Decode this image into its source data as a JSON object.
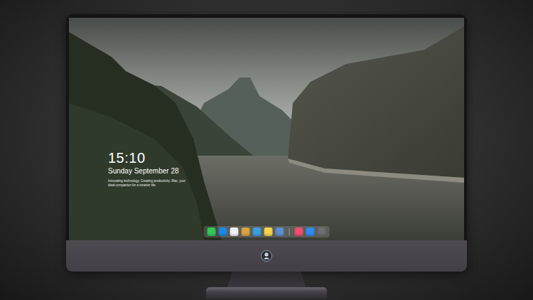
{
  "lock_screen": {
    "time": "15:10",
    "date": "Sunday September 28",
    "motto": "Innovating technology, Creating productivity. Mac, your ideal companion for a smarter life."
  },
  "dock": {
    "items": [
      {
        "kind": "app",
        "color": "#34c759"
      },
      {
        "kind": "app",
        "color": "#1e88e5"
      },
      {
        "kind": "app",
        "color": "#f2f2f2"
      },
      {
        "kind": "app",
        "color": "#d9a441"
      },
      {
        "kind": "app",
        "color": "#3aa0e0"
      },
      {
        "kind": "app",
        "color": "#f7d54a"
      },
      {
        "kind": "app",
        "color": "#5f8fd0"
      },
      {
        "kind": "separator",
        "color": "#9a9a9a"
      },
      {
        "kind": "app",
        "color": "#f0506e"
      },
      {
        "kind": "app",
        "color": "#2f8df5"
      },
      {
        "kind": "app",
        "color": "#6e6e73"
      }
    ]
  }
}
